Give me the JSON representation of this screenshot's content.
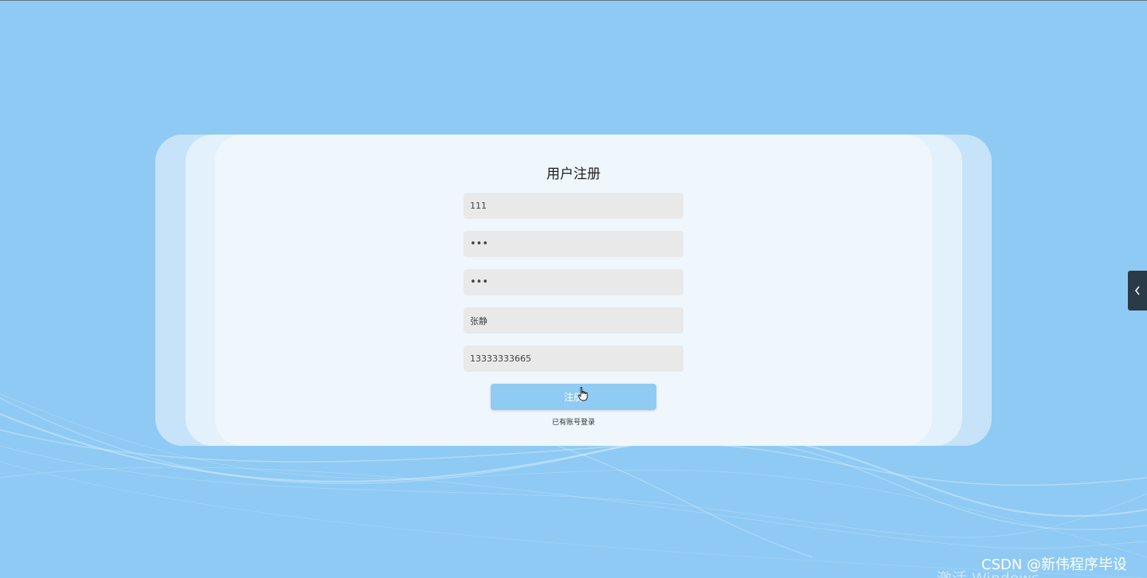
{
  "page": {
    "background_color": "#8ecaf4",
    "card_color": "#eff7fd",
    "accent_color": "#90cbf3"
  },
  "form": {
    "title": "用户注册",
    "username_value": "111",
    "password_value": "•••",
    "confirm_password_value": "•••",
    "name_value": "张静",
    "phone_value": "13333333665",
    "submit_label": "注册",
    "login_link": "已有账号登录"
  },
  "side_tab": {
    "icon": "chevron-left-icon"
  },
  "watermark": {
    "text": "CSDN @新伟程序毕设",
    "activate_text": "激活 Windows"
  }
}
